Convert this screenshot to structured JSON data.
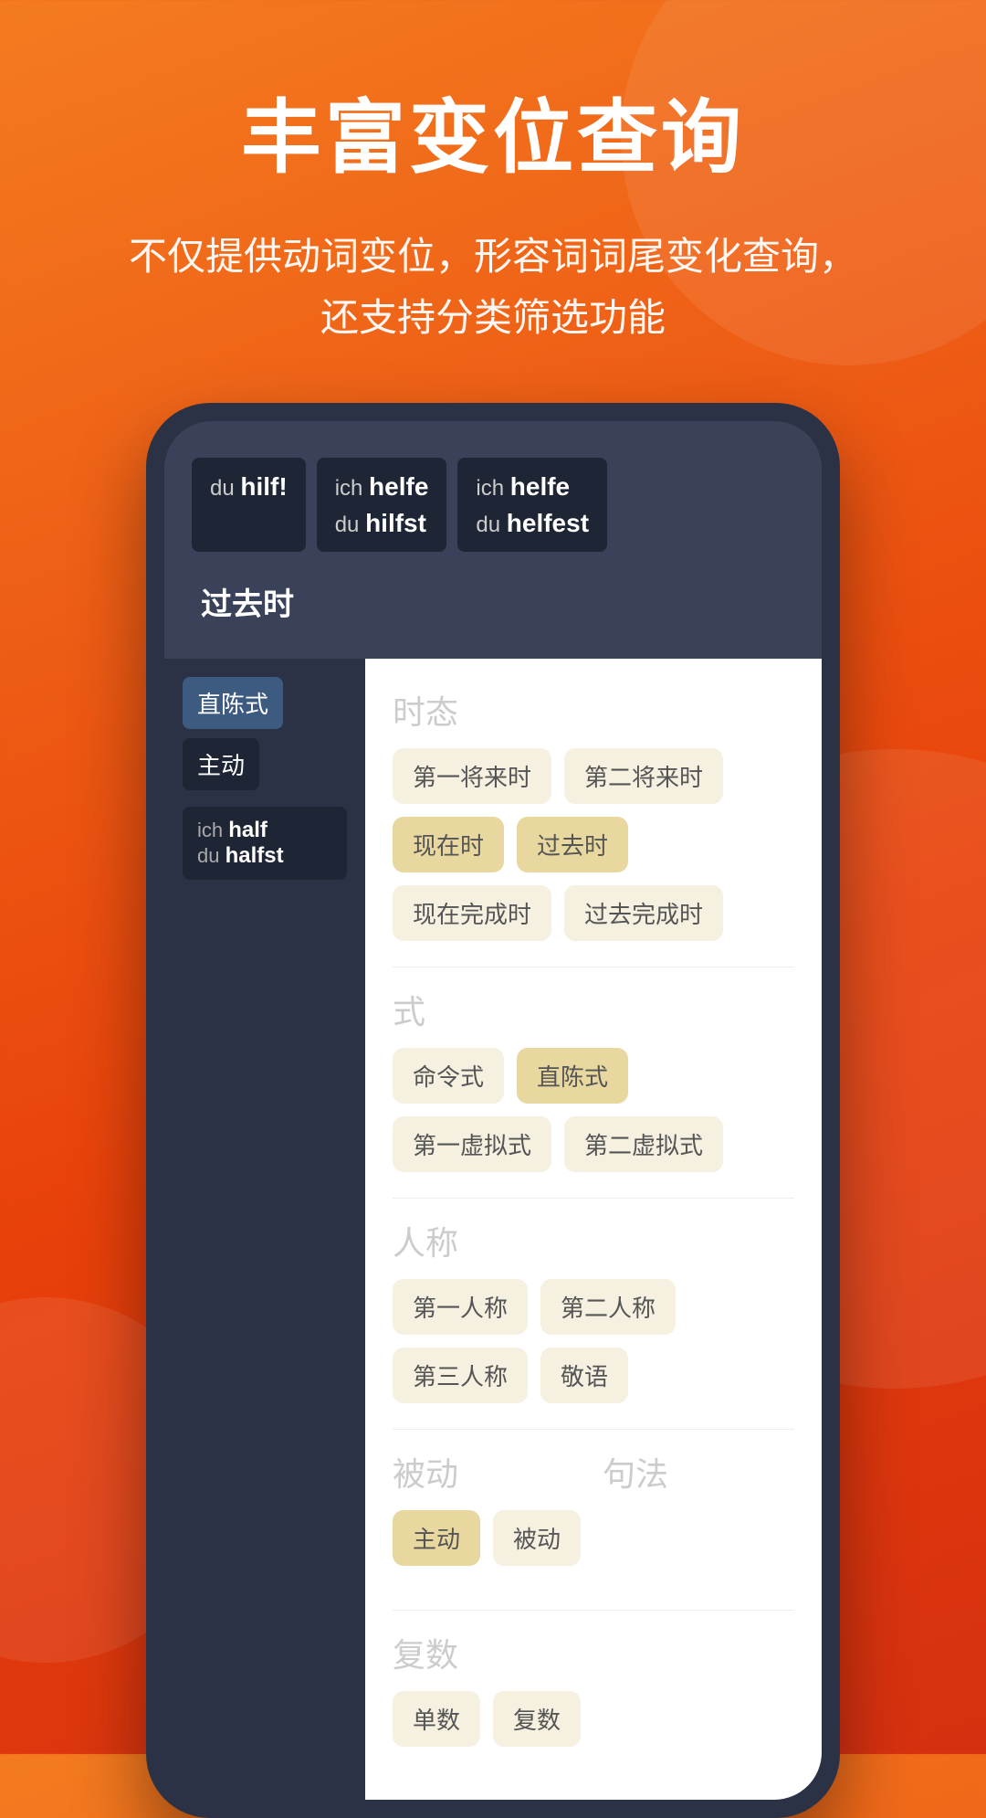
{
  "header": {
    "main_title": "丰富变位查询",
    "subtitle_line1": "不仅提供动词变位，形容词词尾变化查询，",
    "subtitle_line2": "还支持分类筛选功能"
  },
  "phone": {
    "tooltips": [
      {
        "pronoun": "du",
        "verb": "hilf!",
        "lines": 1
      },
      {
        "pronoun_line1": "ich",
        "verb_line1": "helfe",
        "pronoun_line2": "du",
        "verb_line2": "hilfst",
        "lines": 2
      },
      {
        "pronoun_line1": "ich",
        "verb_line1": "helfe",
        "pronoun_line2": "du",
        "verb_line2": "helfest",
        "lines": 2
      }
    ],
    "past_tense_label": "过去时",
    "left_panel": {
      "mode_label": "直陈式",
      "voice_label": "主动",
      "verb_form": {
        "pronoun1": "ich",
        "verb1": "half",
        "pronoun2": "du",
        "verb2": "halfst"
      }
    },
    "filters": {
      "tense": {
        "label": "时态",
        "tags": [
          "第一将来时",
          "第二将来时",
          "现在时",
          "过去时",
          "现在完成时",
          "过去完成时"
        ]
      },
      "mode": {
        "label": "式",
        "tags": [
          "命令式",
          "直陈式",
          "第一虚拟式",
          "第二虚拟式"
        ]
      },
      "person": {
        "label": "人称",
        "tags": [
          "第一人称",
          "第二人称",
          "第三人称",
          "敬语"
        ]
      },
      "voice": {
        "label": "被动",
        "tags": [
          "主动",
          "被动"
        ]
      },
      "syntax_label": "句法",
      "plural": {
        "label": "复数",
        "tags": [
          "单数",
          "复数"
        ]
      }
    }
  }
}
